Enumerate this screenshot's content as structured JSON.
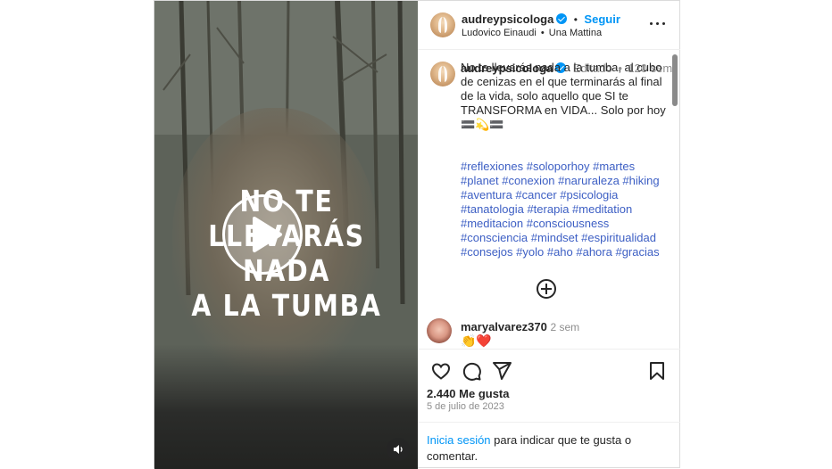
{
  "media": {
    "overlay_lines": [
      "NO TE",
      "LLEVARÁS",
      "NADA",
      "A LA TUMBA"
    ],
    "play_icon": "play-icon",
    "sound_icon": "speaker-icon"
  },
  "header": {
    "username": "audreypsicologa",
    "verified": true,
    "follow_label": "Seguir",
    "separator": "•",
    "audio_artist": "Ludovico Einaudi",
    "audio_track": "Una Mattina",
    "more_icon": "more-horizontal-icon"
  },
  "caption": {
    "username": "audreypsicologa",
    "edited_label": "Editado",
    "separator": "•",
    "age": "120 sem",
    "text": "No te llevarás nada a la tumba, al cubo de cenizas en el que terminarás al final de la vida, solo aquello que SI te TRANSFORMA en VIDA... Solo por hoy",
    "emoji_line": "🟰💫🟰",
    "hashtag_lines": [
      "#reflexiones #soloporhoy #martes",
      "#planet #conexion #naruraleza #hiking",
      "#aventura #cancer #psicologia",
      "#tanatologia #terapia #meditation",
      "#meditacion #consciousness",
      "#consciencia #mindset #espiritualidad",
      "#consejos #yolo #aho #ahora #gracias"
    ]
  },
  "load_more_icon": "plus-circle-icon",
  "comment": {
    "username": "maryalvarez370",
    "age": "2 sem",
    "text": "👏❤️"
  },
  "actions": {
    "like_icon": "heart-icon",
    "comment_icon": "comment-icon",
    "share_icon": "share-icon",
    "save_icon": "bookmark-icon",
    "likes": "2.440 Me gusta",
    "date": "5 de julio de 2023",
    "login_link": "Inicia sesión",
    "login_rest": " para indicar que te gusta o comentar."
  },
  "colors": {
    "accent": "#0095f6",
    "hashtag": "#3d5fc4",
    "text": "#262626",
    "muted": "#8e8e8e"
  }
}
